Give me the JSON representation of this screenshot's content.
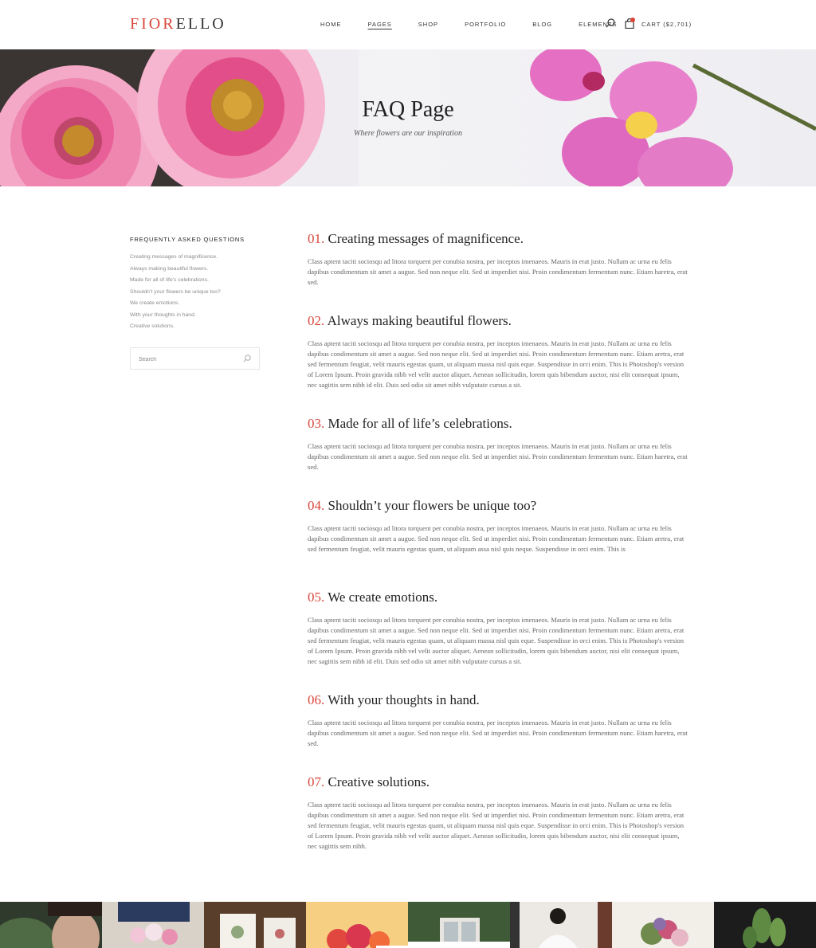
{
  "header": {
    "logo_part1": "FIOR",
    "logo_part2": "ELLO",
    "nav": [
      {
        "label": "HOME",
        "active": false
      },
      {
        "label": "PAGES",
        "active": true
      },
      {
        "label": "SHOP",
        "active": false
      },
      {
        "label": "PORTFOLIO",
        "active": false
      },
      {
        "label": "BLOG",
        "active": false
      },
      {
        "label": "ELEMENTS",
        "active": false
      }
    ],
    "cart_label": "CART ($2,701)",
    "search_icon": "search-icon",
    "cart_icon": "shopping-bag-icon"
  },
  "hero": {
    "title": "FAQ Page",
    "subtitle": "Where flowers are our inspiration"
  },
  "sidebar": {
    "title": "FREQUENTLY ASKED QUESTIONS",
    "links": [
      "Creating messages of magnificence.",
      "Always making beautiful flowers.",
      "Made for all of life’s celebrations.",
      "Shouldn’t your flowers be unique too?",
      "We create emotions.",
      "With your thoughts in hand.",
      "Creative solutions."
    ],
    "search_placeholder": "Search"
  },
  "faq": [
    {
      "num": "01.",
      "question": "Creating messages of magnificence.",
      "answer": "Class aptent taciti sociosqu ad litora torquent per conubia nostra, per inceptos imenaeos. Mauris in erat justo. Nullam ac urna eu felis dapibus condimentum sit amet a augue. Sed non neque elit. Sed ut imperdiet nisi. Proin condimentum fermentum nunc. Etiam haretra, erat sed."
    },
    {
      "num": "02.",
      "question": "Always making beautiful flowers.",
      "answer": "Class aptent taciti sociosqu ad litora torquent per conubia nostra, per inceptos imenaeos. Mauris in erat justo. Nullam ac urna eu felis dapibus condimentum sit amet a augue. Sed non neque elit. Sed ut imperdiet nisi. Proin condimentum fermentum nunc. Etiam aretra, erat sed fermentum feugiat, velit mauris egestas quam, ut aliquam massa nisl quis eque. Suspendisse in orci enim. This is Photoshop's version of Lorem Ipsum. Proin gravida nibh vel velit auctor aliquet. Aenean sollicitudin, lorem quis bibendum auctor, nisi elit consequat ipsum, nec sagittis sem nibh id elit. Duis sed odio sit amet nibh vulputate cursus a sit."
    },
    {
      "num": "03.",
      "question": "Made for all of life’s celebrations.",
      "answer": "Class aptent taciti sociosqu ad litora torquent per conubia nostra, per inceptos imenaeos. Mauris in erat justo. Nullam ac urna eu felis dapibus condimentum sit amet a augue. Sed non neque elit. Sed ut imperdiet nisi. Proin condimentum fermentum nunc. Etiam haretra, erat sed."
    },
    {
      "num": "04.",
      "question": "Shouldn’t your flowers be unique too?",
      "answer": "Class aptent taciti sociosqu ad litora torquent per conubia nostra, per inceptos imenaeos. Mauris in erat justo. Nullam ac urna eu felis dapibus condimentum sit amet a augue. Sed non neque elit. Sed ut imperdiet nisi. Proin condimentum fermentum nunc. Etiam aretra, erat sed fermentum feugiat, velit mauris egestas quam, ut aliquam assa nisl quis neque. Suspendisse in orci enim. This is"
    },
    {
      "num": "05.",
      "question": "We create emotions.",
      "answer": "Class aptent taciti sociosqu ad litora torquent per conubia nostra, per inceptos imenaeos. Mauris in erat justo. Nullam ac urna eu felis dapibus condimentum sit amet a augue. Sed non neque elit. Sed ut imperdiet nisi. Proin condimentum fermentum nunc. Etiam aretra, erat sed fermentum feugiat, velit mauris egestas quam, ut aliquam massa nisl quis eque. Suspendisse in orci enim. This is Photoshop's version of Lorem Ipsum. Proin gravida nibh vel velit auctor aliquet. Aenean sollicitudin, lorem quis bibendum auctor, nisi elit consequat ipsum, nec sagittis sem nibh id elit. Duis sed odio sit amet nibh vulputate cursus a sit."
    },
    {
      "num": "06.",
      "question": "With your thoughts in hand.",
      "answer": "Class aptent taciti sociosqu ad litora torquent per conubia nostra, per inceptos imenaeos. Mauris in erat justo. Nullam ac urna eu felis dapibus condimentum sit amet a augue. Sed non neque elit. Sed ut imperdiet nisi. Proin condimentum fermentum nunc. Etiam haretra, erat sed."
    },
    {
      "num": "07.",
      "question": "Creative solutions.",
      "answer": "Class aptent taciti sociosqu ad litora torquent per conubia nostra, per inceptos imenaeos. Mauris in erat justo. Nullam ac urna eu felis dapibus condimentum sit amet a augue. Sed non neque elit. Sed ut imperdiet nisi. Proin condimentum fermentum nunc. Etiam aretra, erat sed fermentum feugiat, velit mauris egestas quam, ut aliquam massa nisl quis eque. Suspendisse in orci enim. This is Photoshop's version of Lorem Ipsum. Proin gravida nibh vel velit auctor aliquet. Aenean sollicitudin, lorem quis bibendum auctor, nisi elit consequat ipsum, nec sagittis sem nibh."
    }
  ],
  "gallery": [
    "portrait-woman-leaf",
    "tulip-bouquet",
    "botanical-cards",
    "red-roses-yellow",
    "flower-shop-window",
    "woman-white-shirt",
    "mixed-bouquet",
    "green-plant-dark"
  ],
  "colors": {
    "accent": "#d9473b",
    "text": "#222222",
    "muted": "#666666"
  }
}
